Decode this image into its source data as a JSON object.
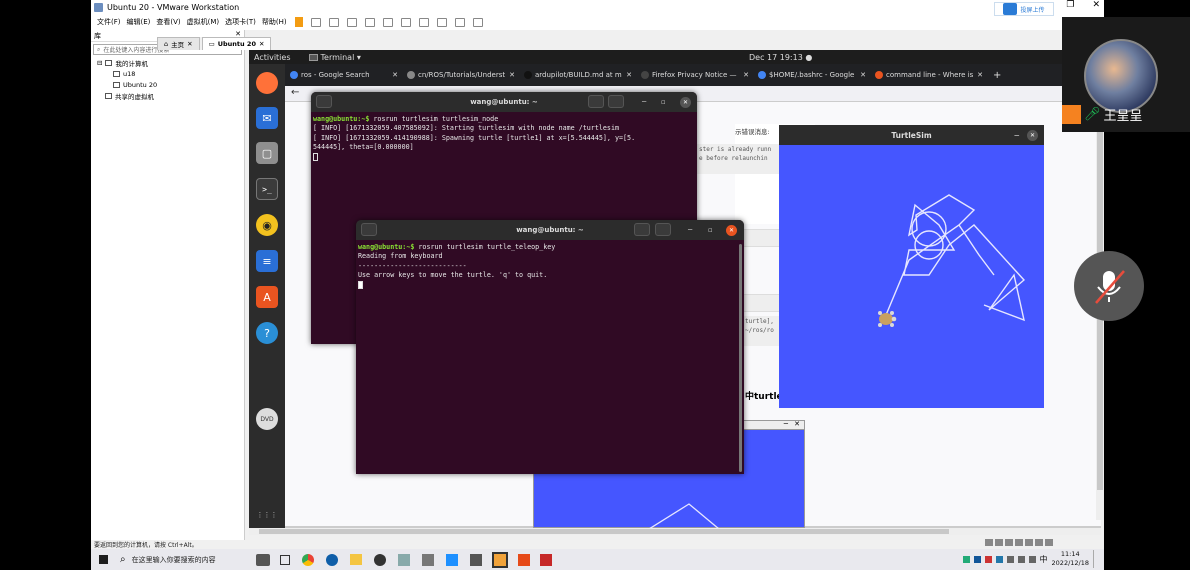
{
  "vmware": {
    "title": "Ubuntu 20 - VMware Workstation",
    "menu": [
      "文件(F)",
      "编辑(E)",
      "查看(V)",
      "虚拟机(M)",
      "选项卡(T)",
      "帮助(H)"
    ],
    "share_label": "投屏上传",
    "library_title": "库",
    "library_close": "✕",
    "search_placeholder": "在此处键入内容进行搜索",
    "tree": {
      "root": "我的计算机",
      "vm1": "u18",
      "vm2": "Ubuntu 20",
      "shared": "共享的虚拟机"
    },
    "tabs": [
      "主页",
      "Ubuntu 20"
    ],
    "status": "要返回到您的计算机，请按 Ctrl+Alt。"
  },
  "ubuntu": {
    "activities": "Activities",
    "app_menu": "Terminal ▾",
    "clock": "Dec 17  19:13  ●"
  },
  "firefox": {
    "tabs": [
      {
        "label": "ros - Google Search",
        "color": "#4285f4"
      },
      {
        "label": "cn/ROS/Tutorials/Underst",
        "color": "#888888"
      },
      {
        "label": "ardupilot/BUILD.md at m",
        "color": "#222222"
      },
      {
        "label": "Firefox Privacy Notice —",
        "color": "#333333"
      },
      {
        "label": "$HOME/.bashrc - Google",
        "color": "#4285f4"
      },
      {
        "label": "command line - Where is",
        "color": "#e95420"
      }
    ],
    "new_tab": "+",
    "page_text": {
      "l1": "示错误消息:",
      "l2": "ster is already runn",
      "l3": "e before relaunchin",
      "l4": "turtle],",
      "l5": "~/ros/ro",
      "l6": "中turtle_t"
    }
  },
  "terminal1": {
    "title": "wang@ubuntu: ~",
    "prompt": "wang@ubuntu:~$",
    "cmd": " rosrun turtlesim turtlesim_node",
    "line2": "[ INFO] [1671332059.407585092]: Starting turtlesim with node name /turtlesim",
    "line3": "[ INFO] [1671332059.414190988]: Spawning turtle [turtle1] at x=[5.544445], y=[5.",
    "line4": "544445], theta=[0.000000]"
  },
  "terminal2": {
    "title": "wang@ubuntu: ~",
    "prompt": "wang@ubuntu:~$",
    "cmd": " rosrun turtlesim turtle_teleop_key",
    "line2": "Reading from keyboard",
    "line3": "---------------------------",
    "line4": "Use arrow keys to move the turtle. 'q' to quit."
  },
  "turtlesim": {
    "title": "TurtleSim",
    "bg": "#4556ff"
  },
  "meeting": {
    "username": "王呈呈"
  },
  "taskbar": {
    "search_placeholder": "在这里输入你要搜索的内容",
    "ime": "中",
    "time": "11:14",
    "date": "2022/12/18"
  },
  "colors": {
    "ubuntu_orange": "#e95420",
    "terminal_bg": "#300a24",
    "prompt": "#8ae234"
  }
}
